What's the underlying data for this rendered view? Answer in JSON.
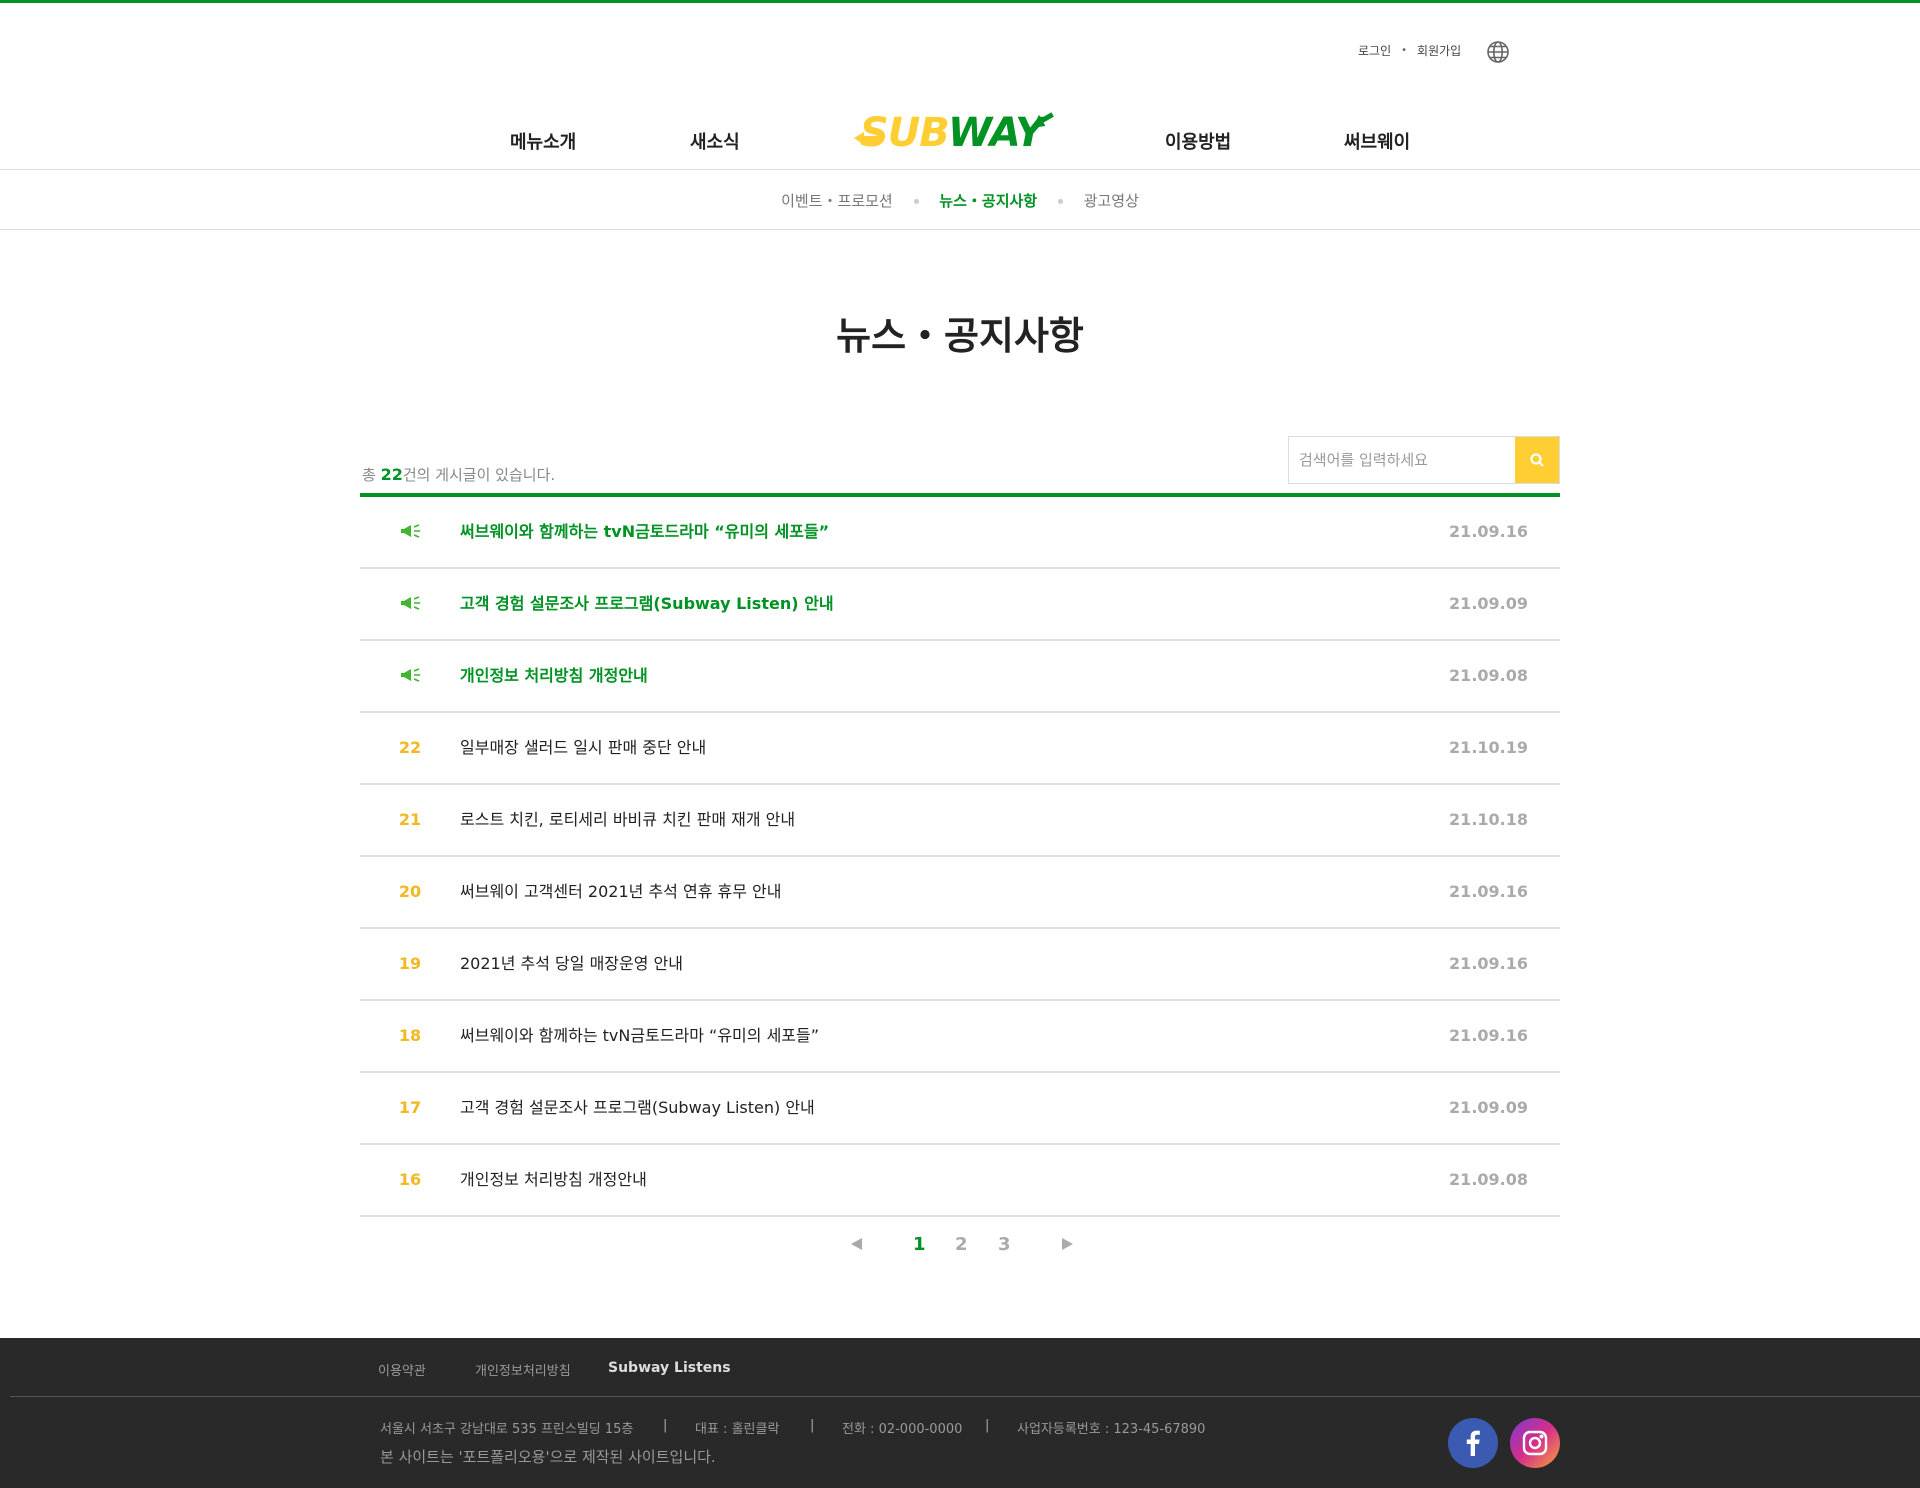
{
  "header": {
    "login_label": "로그인",
    "join_label": "회원가입",
    "dot": "•",
    "nav": [
      {
        "label": "메뉴소개",
        "active": true
      },
      {
        "label": "새소식",
        "active": false
      },
      {
        "label": "이용방법",
        "active": false
      },
      {
        "label": "써브웨이",
        "active": false
      }
    ],
    "logo_text": "SUBWAY",
    "brand_colors": {
      "green": "#009223",
      "yellow": "#ffce32"
    }
  },
  "subnav": [
    {
      "label": "이벤트・프로모션",
      "active": false
    },
    {
      "label": "뉴스・공지사항",
      "active": true
    },
    {
      "label": "광고영상",
      "active": false
    }
  ],
  "page": {
    "title": "뉴스・공지사항",
    "total_prefix": "총 ",
    "total_count": "22",
    "total_suffix": "건의 게시글이 있습니다.",
    "search_placeholder": "검색어를 입력하세요",
    "search_icon": "search-icon"
  },
  "notices": [
    {
      "title": "써브웨이와 함께하는 tvN금토드라마 “유미의 세포들”",
      "date": "21.09.16"
    },
    {
      "title": "고객 경험 설문조사 프로그램(Subway Listen) 안내",
      "date": "21.09.09"
    },
    {
      "title": "개인정보 처리방침 개정안내",
      "date": "21.09.08"
    }
  ],
  "posts": [
    {
      "num": "22",
      "title": "일부매장 샐러드 일시 판매 중단 안내",
      "date": "21.10.19"
    },
    {
      "num": "21",
      "title": "로스트 치킨, 로티세리 바비큐 치킨 판매 재개 안내",
      "date": "21.10.18"
    },
    {
      "num": "20",
      "title": "써브웨이 고객센터 2021년 추석 연휴 휴무 안내",
      "date": "21.09.16"
    },
    {
      "num": "19",
      "title": "2021년 추석 당일 매장운영 안내",
      "date": "21.09.16"
    },
    {
      "num": "18",
      "title": "써브웨이와 함께하는 tvN금토드라마 “유미의 세포들”",
      "date": "21.09.16"
    },
    {
      "num": "17",
      "title": "고객 경험 설문조사 프로그램(Subway Listen) 안내",
      "date": "21.09.09"
    },
    {
      "num": "16",
      "title": "개인정보 처리방침 개정안내",
      "date": "21.09.08"
    }
  ],
  "pagination": {
    "pages": [
      "1",
      "2",
      "3"
    ],
    "current": "1"
  },
  "footer": {
    "links": [
      "이용약관",
      "개인정보처리방침",
      "Subway Listens"
    ],
    "address": "서울시 서초구 강남대로 535 프린스빌딩 15층",
    "ceo": "대표 : 홀린클락",
    "phone": "전화 : 02-000-0000",
    "biz_no": "사업자등록번호 : 123-45-67890",
    "separator": "|",
    "copyright": "본 사이트는 '포트폴리오용'으로 제작된 사이트입니다.",
    "sns": [
      "facebook-icon",
      "instagram-icon"
    ]
  }
}
